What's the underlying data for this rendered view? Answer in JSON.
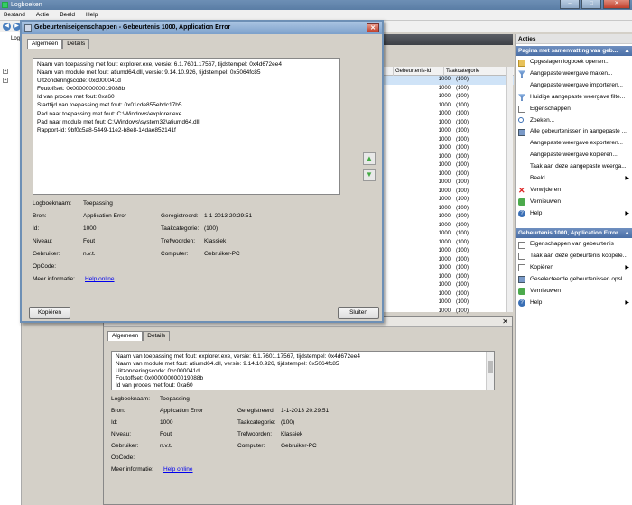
{
  "window": {
    "title": "Logboeken"
  },
  "menu": [
    "Bestand",
    "Actie",
    "Beeld",
    "Help"
  ],
  "tree": {
    "label": "Log"
  },
  "grid": {
    "columns": [
      "Gebeurtenis-id",
      "Taakcategorie"
    ],
    "rows": [
      [
        "1000",
        "(100)"
      ],
      [
        "1000",
        "(100)"
      ],
      [
        "1000",
        "(100)"
      ],
      [
        "1000",
        "(100)"
      ],
      [
        "1000",
        "(100)"
      ],
      [
        "1000",
        "(100)"
      ],
      [
        "1000",
        "(100)"
      ],
      [
        "1000",
        "(100)"
      ],
      [
        "1000",
        "(100)"
      ],
      [
        "1000",
        "(100)"
      ],
      [
        "1000",
        "(100)"
      ],
      [
        "1000",
        "(100)"
      ],
      [
        "1000",
        "(100)"
      ],
      [
        "1000",
        "(100)"
      ],
      [
        "1000",
        "(100)"
      ],
      [
        "1000",
        "(100)"
      ],
      [
        "1000",
        "(100)"
      ],
      [
        "1000",
        "(100)"
      ],
      [
        "1000",
        "(100)"
      ],
      [
        "1000",
        "(100)"
      ],
      [
        "1000",
        "(100)"
      ],
      [
        "1000",
        "(100)"
      ],
      [
        "1000",
        "(100)"
      ],
      [
        "1000",
        "(100)"
      ],
      [
        "1000",
        "(100)"
      ],
      [
        "1000",
        "(100)"
      ],
      [
        "1000",
        "(100)"
      ],
      [
        "1000",
        "(100)"
      ]
    ]
  },
  "dialog": {
    "title": "Gebeurteniseigenschappen - Gebeurtenis 1000, Application Error",
    "tabs": [
      "Algemeen",
      "Details"
    ],
    "description": [
      "Naam van toepassing met fout: explorer.exe, versie: 6.1.7601.17567, tijdstempel: 0x4d672ee4",
      "Naam van module met fout: atiumd64.dll, versie: 9.14.10.926, tijdstempel: 0x5064fc85",
      "Uitzonderingscode: 0xc000041d",
      "Foutoffset: 0x000000000019088b",
      "Id van proces met fout: 0xa60",
      "Starttijd van toepassing met fout: 0x01cde855ebdc17b5",
      "Pad naar toepassing met fout: C:\\Windows\\explorer.exe",
      "Pad naar module met fout: C:\\Windows\\system32\\atiumd64.dll",
      "Rapport-id: 9bf0c5a8-5449-11e2-b8e8-14dae852141f"
    ],
    "fields": {
      "logboeknaam_label": "Logboeknaam:",
      "logboeknaam": "Toepassing",
      "bron_label": "Bron:",
      "bron": "Application Error",
      "geregistreerd_label": "Geregistreerd:",
      "geregistreerd": "1-1-2013 20:29:51",
      "id_label": "Id:",
      "id": "1000",
      "taakcategorie_label": "Taakcategorie:",
      "taakcategorie": "(100)",
      "niveau_label": "Niveau:",
      "niveau": "Fout",
      "trefwoorden_label": "Trefwoorden:",
      "trefwoorden": "Klassiek",
      "gebruiker_label": "Gebruiker:",
      "gebruiker": "n.v.t.",
      "computer_label": "Computer:",
      "computer": "Gebruiker-PC",
      "opcode_label": "OpCode:",
      "opcode": "",
      "meer_label": "Meer informatie:",
      "meer_link": "Help online"
    },
    "copy_button": "Kopiëren",
    "close_button": "Sluiten"
  },
  "detail": {
    "tabs": [
      "Algemeen",
      "Details"
    ],
    "description": [
      "Naam van toepassing met fout: explorer.exe, versie: 6.1.7601.17567, tijdstempel: 0x4d672ee4",
      "Naam van module met fout: atiumd64.dll, versie: 9.14.10.926, tijdstempel: 0x5064fc85",
      "Uitzonderingscode: 0xc000041d",
      "Foutoffset: 0x000000000019088b",
      "Id van proces met fout: 0xa60"
    ]
  },
  "actions": {
    "title": "Acties",
    "section1": "Pagina met samenvatting van geb...",
    "items1": [
      {
        "label": "Opgeslagen logboek openen...",
        "icon": "folder-icon",
        "sub": ""
      },
      {
        "label": "Aangepaste weergave maken...",
        "icon": "filter-icon",
        "sub": ""
      },
      {
        "label": "Aangepaste weergave importeren...",
        "icon": "blank",
        "sub": ""
      },
      {
        "label": "Huidige aangepaste weergave filte...",
        "icon": "filter-icon",
        "sub": ""
      },
      {
        "label": "Eigenschappen",
        "icon": "doc-icon",
        "sub": ""
      },
      {
        "label": "Zoeken...",
        "icon": "find-icon",
        "sub": ""
      },
      {
        "label": "Alle gebeurtenissen in aangepaste ...",
        "icon": "save-icon",
        "sub": ""
      },
      {
        "label": "Aangepaste weergave exporteren...",
        "icon": "blank",
        "sub": ""
      },
      {
        "label": "Aangepaste weergave kopiëren...",
        "icon": "blank",
        "sub": ""
      },
      {
        "label": "Taak aan deze aangepaste weerga...",
        "icon": "blank",
        "sub": ""
      },
      {
        "label": "Beeld",
        "icon": "blank",
        "sub": "▶"
      },
      {
        "label": "Verwijderen",
        "icon": "delete-icon",
        "sub": ""
      },
      {
        "label": "Vernieuwen",
        "icon": "refresh-icon",
        "sub": ""
      },
      {
        "label": "Help",
        "icon": "help-icon",
        "sub": "▶"
      }
    ],
    "section2": "Gebeurtenis 1000, Application Error",
    "items2": [
      {
        "label": "Eigenschappen van gebeurtenis",
        "icon": "doc-icon",
        "sub": ""
      },
      {
        "label": "Taak aan deze gebeurtenis koppele...",
        "icon": "doc-icon",
        "sub": ""
      },
      {
        "label": "Kopiëren",
        "icon": "doc-icon",
        "sub": "▶"
      },
      {
        "label": "Geselecteerde gebeurtenissen opsl...",
        "icon": "save-icon",
        "sub": ""
      },
      {
        "label": "Vernieuwen",
        "icon": "refresh-icon",
        "sub": ""
      },
      {
        "label": "Help",
        "icon": "help-icon",
        "sub": "▶"
      }
    ]
  }
}
